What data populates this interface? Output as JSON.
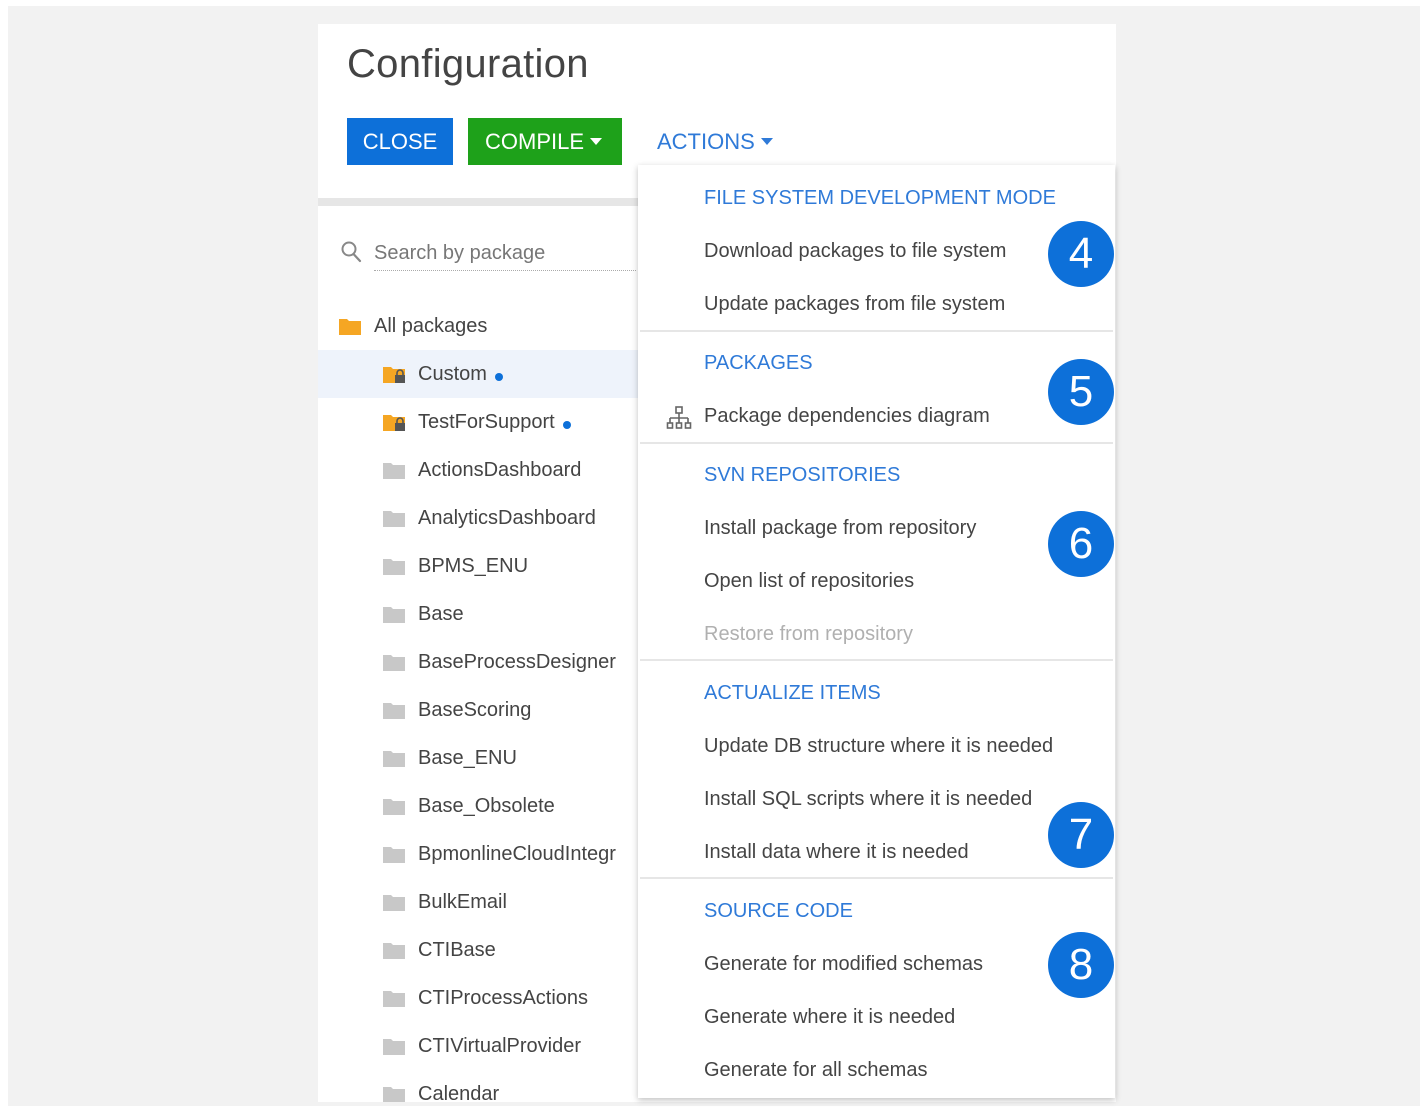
{
  "page": {
    "title": "Configuration"
  },
  "toolbar": {
    "close_label": "CLOSE",
    "compile_label": "COMPILE",
    "actions_label": "ACTIONS",
    "close_color": "#0d70d9",
    "compile_color": "#1ea11a",
    "actions_color": "#2f7ad8"
  },
  "search": {
    "placeholder": "Search by package",
    "icon": "search-icon"
  },
  "tree": {
    "items": [
      {
        "label": "All packages",
        "icon": "folder-icon"
      },
      {
        "label": "Custom",
        "icon": "locked-folder-icon",
        "selected": true,
        "modified": true
      },
      {
        "label": "TestForSupport",
        "icon": "locked-folder-icon",
        "modified": true
      },
      {
        "label": "ActionsDashboard",
        "icon": "folder-icon"
      },
      {
        "label": "AnalyticsDashboard",
        "icon": "folder-icon"
      },
      {
        "label": "BPMS_ENU",
        "icon": "folder-icon"
      },
      {
        "label": "Base",
        "icon": "folder-icon"
      },
      {
        "label": "BaseProcessDesigner",
        "icon": "folder-icon"
      },
      {
        "label": "BaseScoring",
        "icon": "folder-icon"
      },
      {
        "label": "Base_ENU",
        "icon": "folder-icon"
      },
      {
        "label": "Base_Obsolete",
        "icon": "folder-icon"
      },
      {
        "label": "BpmonlineCloudIntegr",
        "icon": "folder-icon"
      },
      {
        "label": "BulkEmail",
        "icon": "folder-icon"
      },
      {
        "label": "CTIBase",
        "icon": "folder-icon"
      },
      {
        "label": "CTIProcessActions",
        "icon": "folder-icon"
      },
      {
        "label": "CTIVirtualProvider",
        "icon": "folder-icon"
      },
      {
        "label": "Calendar",
        "icon": "folder-icon"
      }
    ]
  },
  "menu": {
    "sections": [
      {
        "header": "FILE SYSTEM DEVELOPMENT MODE",
        "items": [
          {
            "label": "Download packages to file system"
          },
          {
            "label": "Update packages from file system"
          }
        ]
      },
      {
        "header": "PACKAGES",
        "items": [
          {
            "label": "Package dependencies diagram",
            "icon": "hierarchy-icon"
          }
        ]
      },
      {
        "header": "SVN REPOSITORIES",
        "items": [
          {
            "label": "Install package from repository"
          },
          {
            "label": "Open list of repositories"
          },
          {
            "label": "Restore from repository",
            "disabled": true
          }
        ]
      },
      {
        "header": "ACTUALIZE ITEMS",
        "items": [
          {
            "label": "Update DB structure where it is needed"
          },
          {
            "label": "Install SQL scripts where it is needed"
          },
          {
            "label": "Install data where it is needed"
          }
        ]
      },
      {
        "header": "SOURCE CODE",
        "items": [
          {
            "label": "Generate for modified schemas"
          },
          {
            "label": "Generate where it is needed"
          },
          {
            "label": "Generate for all schemas"
          }
        ]
      }
    ]
  },
  "badges": [
    "4",
    "5",
    "6",
    "7",
    "8"
  ]
}
